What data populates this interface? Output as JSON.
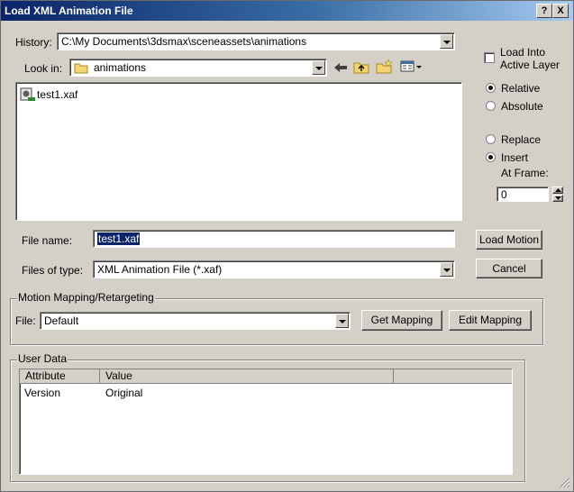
{
  "window": {
    "title": "Load XML Animation File",
    "help_btn": "?",
    "close_btn": "X"
  },
  "history": {
    "label": "History:",
    "value": "C:\\My Documents\\3dsmax\\sceneassets\\animations"
  },
  "lookin": {
    "label": "Look in:",
    "value": "animations"
  },
  "files": [
    {
      "name": "test1.xaf"
    }
  ],
  "options": {
    "load_into_active_layer": "Load Into\nActive Layer",
    "relative": "Relative",
    "absolute": "Absolute",
    "replace": "Replace",
    "insert": "Insert",
    "at_frame": "At Frame:",
    "frame_value": "0"
  },
  "filename": {
    "label": "File name:",
    "value": "test1.xaf"
  },
  "filetype": {
    "label": "Files of type:",
    "value": "XML Animation File (*.xaf)"
  },
  "buttons": {
    "load_motion": "Load Motion",
    "cancel": "Cancel"
  },
  "mapping": {
    "group_label": "Motion Mapping/Retargeting",
    "file_label": "File:",
    "file_value": "Default",
    "get_mapping": "Get Mapping",
    "edit_mapping": "Edit Mapping"
  },
  "userdata": {
    "group_label": "User Data",
    "headers": [
      "Attribute",
      "Value"
    ],
    "rows": [
      {
        "attribute": "Version",
        "value": "Original"
      }
    ]
  }
}
